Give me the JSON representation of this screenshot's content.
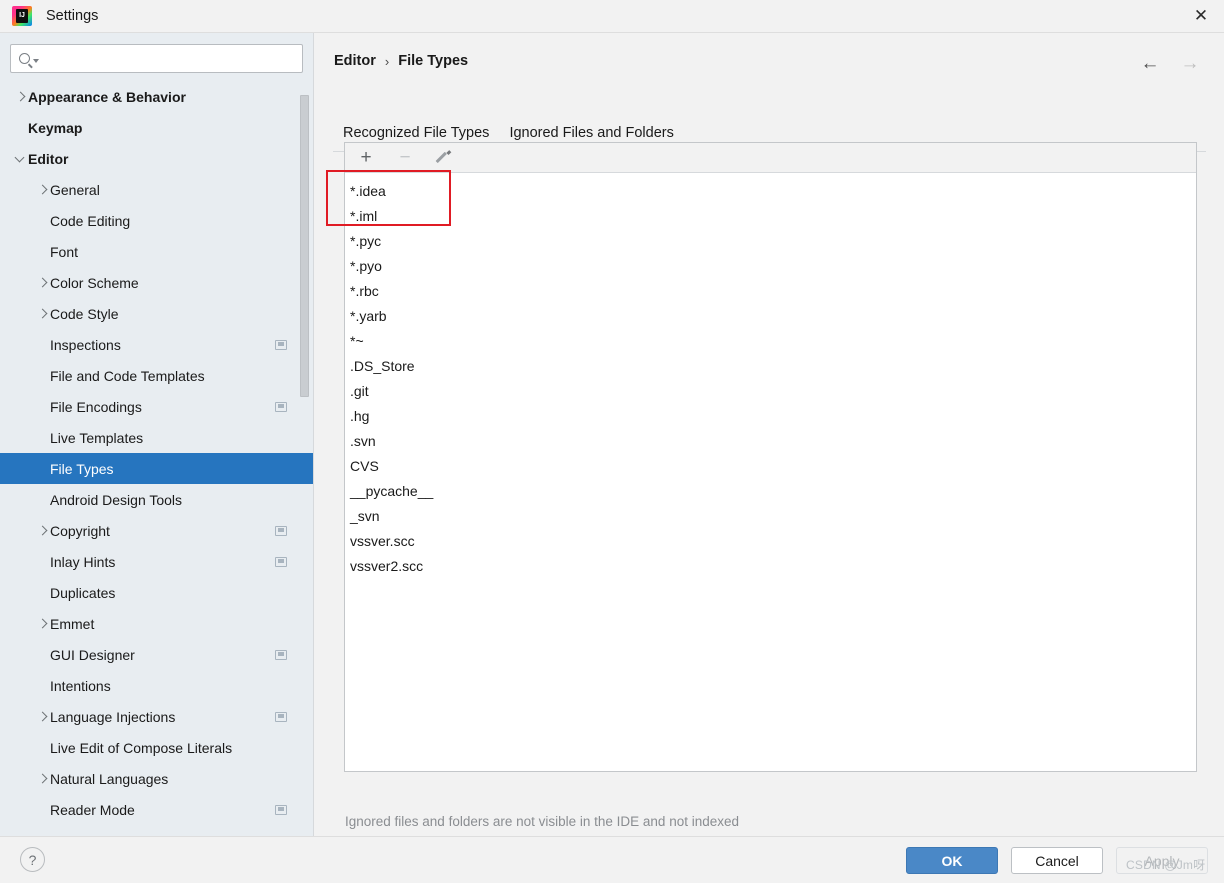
{
  "window": {
    "title": "Settings",
    "app_icon": "intellij-idea-icon",
    "close_icon": "close-icon"
  },
  "search": {
    "placeholder": "",
    "value": "",
    "icon": "search-icon",
    "caret_icon": "chevron-down-icon"
  },
  "sidebar": {
    "items": [
      {
        "label": "Appearance & Behavior",
        "indent": 0,
        "chevron": "right",
        "bold": true,
        "selected": false,
        "badge": false
      },
      {
        "label": "Keymap",
        "indent": 0,
        "chevron": "none",
        "bold": true,
        "selected": false,
        "badge": false
      },
      {
        "label": "Editor",
        "indent": 0,
        "chevron": "down",
        "bold": true,
        "selected": false,
        "badge": false
      },
      {
        "label": "General",
        "indent": 1,
        "chevron": "right",
        "bold": false,
        "selected": false,
        "badge": false
      },
      {
        "label": "Code Editing",
        "indent": 1,
        "chevron": "none",
        "bold": false,
        "selected": false,
        "badge": false
      },
      {
        "label": "Font",
        "indent": 1,
        "chevron": "none",
        "bold": false,
        "selected": false,
        "badge": false
      },
      {
        "label": "Color Scheme",
        "indent": 1,
        "chevron": "right",
        "bold": false,
        "selected": false,
        "badge": false
      },
      {
        "label": "Code Style",
        "indent": 1,
        "chevron": "right",
        "bold": false,
        "selected": false,
        "badge": false
      },
      {
        "label": "Inspections",
        "indent": 1,
        "chevron": "none",
        "bold": false,
        "selected": false,
        "badge": true
      },
      {
        "label": "File and Code Templates",
        "indent": 1,
        "chevron": "none",
        "bold": false,
        "selected": false,
        "badge": false
      },
      {
        "label": "File Encodings",
        "indent": 1,
        "chevron": "none",
        "bold": false,
        "selected": false,
        "badge": true
      },
      {
        "label": "Live Templates",
        "indent": 1,
        "chevron": "none",
        "bold": false,
        "selected": false,
        "badge": false
      },
      {
        "label": "File Types",
        "indent": 1,
        "chevron": "none",
        "bold": false,
        "selected": true,
        "badge": false
      },
      {
        "label": "Android Design Tools",
        "indent": 1,
        "chevron": "none",
        "bold": false,
        "selected": false,
        "badge": false
      },
      {
        "label": "Copyright",
        "indent": 1,
        "chevron": "right",
        "bold": false,
        "selected": false,
        "badge": true
      },
      {
        "label": "Inlay Hints",
        "indent": 1,
        "chevron": "none",
        "bold": false,
        "selected": false,
        "badge": true
      },
      {
        "label": "Duplicates",
        "indent": 1,
        "chevron": "none",
        "bold": false,
        "selected": false,
        "badge": false
      },
      {
        "label": "Emmet",
        "indent": 1,
        "chevron": "right",
        "bold": false,
        "selected": false,
        "badge": false
      },
      {
        "label": "GUI Designer",
        "indent": 1,
        "chevron": "none",
        "bold": false,
        "selected": false,
        "badge": true
      },
      {
        "label": "Intentions",
        "indent": 1,
        "chevron": "none",
        "bold": false,
        "selected": false,
        "badge": false
      },
      {
        "label": "Language Injections",
        "indent": 1,
        "chevron": "right",
        "bold": false,
        "selected": false,
        "badge": true
      },
      {
        "label": "Live Edit of Compose Literals",
        "indent": 1,
        "chevron": "none",
        "bold": false,
        "selected": false,
        "badge": false
      },
      {
        "label": "Natural Languages",
        "indent": 1,
        "chevron": "right",
        "bold": false,
        "selected": false,
        "badge": false
      },
      {
        "label": "Reader Mode",
        "indent": 1,
        "chevron": "none",
        "bold": false,
        "selected": false,
        "badge": true
      }
    ]
  },
  "header": {
    "breadcrumb_root": "Editor",
    "breadcrumb_separator": "›",
    "breadcrumb_current": "File Types",
    "back_icon": "arrow-left-icon",
    "forward_icon": "arrow-right-icon"
  },
  "tabs": [
    {
      "label": "Recognized File Types",
      "active": false
    },
    {
      "label": "Ignored Files and Folders",
      "active": true
    }
  ],
  "toolbar": {
    "add_label": "+",
    "remove_label": "−",
    "edit_icon": "pencil-icon",
    "add_icon": "plus-icon",
    "remove_icon": "minus-icon"
  },
  "list": {
    "items": [
      "*.idea",
      "*.iml",
      "*.pyc",
      "*.pyo",
      "*.rbc",
      "*.yarb",
      "*~",
      ".DS_Store",
      ".git",
      ".hg",
      ".svn",
      "CVS",
      "__pycache__",
      "_svn",
      "vssver.scc",
      "vssver2.scc"
    ]
  },
  "hint": "Ignored files and folders are not visible in the IDE and not indexed",
  "footer": {
    "help_label": "?",
    "ok_label": "OK",
    "cancel_label": "Cancel",
    "apply_label": "Apply"
  },
  "watermark": "CSDN @Jm呀",
  "colors": {
    "accent": "#4a88c7",
    "selection": "#2675bf",
    "annotation": "#e01b24",
    "sidebar_bg": "#e8edf1",
    "panel_bg": "#ffffff"
  }
}
